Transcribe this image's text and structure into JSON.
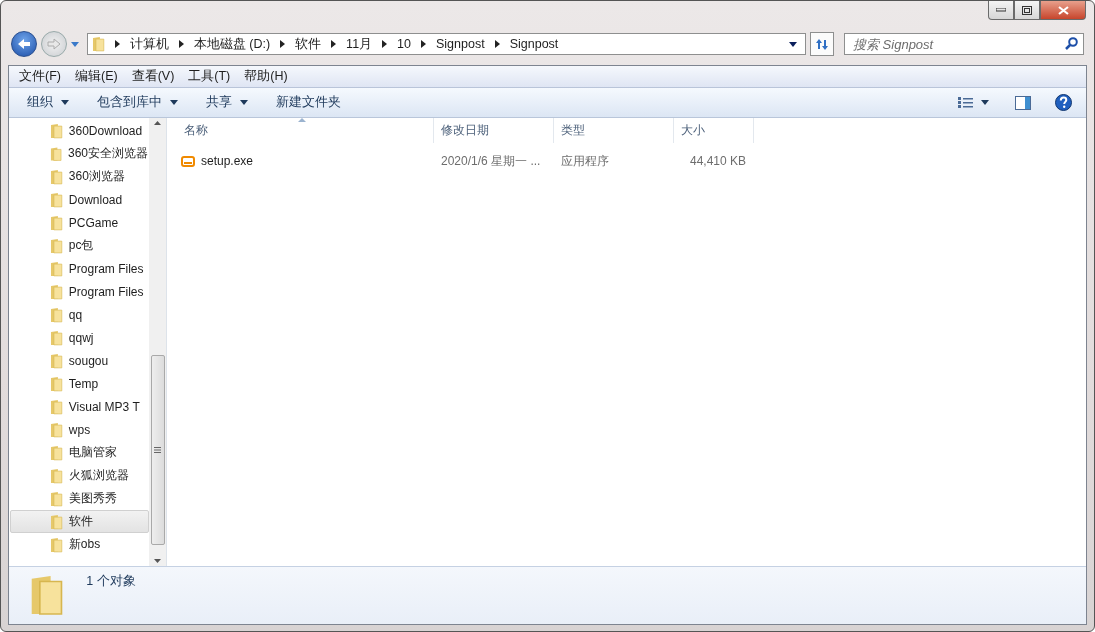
{
  "address_bar": {
    "crumbs": [
      "计算机",
      "本地磁盘 (D:)",
      "软件",
      "11月",
      "10",
      "Signpost",
      "Signpost"
    ]
  },
  "search": {
    "placeholder": "搜索 Signpost"
  },
  "menu_bar": [
    "文件(F)",
    "编辑(E)",
    "查看(V)",
    "工具(T)",
    "帮助(H)"
  ],
  "command_bar": [
    {
      "label": "组织",
      "dropdown": true
    },
    {
      "label": "包含到库中",
      "dropdown": true
    },
    {
      "label": "共享",
      "dropdown": true
    },
    {
      "label": "新建文件夹",
      "dropdown": false
    }
  ],
  "sidebar": {
    "items": [
      {
        "label": "360Download",
        "selected": false
      },
      {
        "label": "360安全浏览器",
        "selected": false
      },
      {
        "label": "360浏览器",
        "selected": false
      },
      {
        "label": "Download",
        "selected": false
      },
      {
        "label": "PCGame",
        "selected": false
      },
      {
        "label": "pc包",
        "selected": false
      },
      {
        "label": "Program Files",
        "selected": false
      },
      {
        "label": "Program Files",
        "selected": false
      },
      {
        "label": "qq",
        "selected": false
      },
      {
        "label": "qqwj",
        "selected": false
      },
      {
        "label": "sougou",
        "selected": false
      },
      {
        "label": "Temp",
        "selected": false
      },
      {
        "label": "Visual MP3 T",
        "selected": false
      },
      {
        "label": "wps",
        "selected": false
      },
      {
        "label": "电脑管家",
        "selected": false
      },
      {
        "label": "火狐浏览器",
        "selected": false
      },
      {
        "label": "美图秀秀",
        "selected": false
      },
      {
        "label": "软件",
        "selected": true
      },
      {
        "label": "新obs",
        "selected": false
      }
    ]
  },
  "table": {
    "columns": [
      "名称",
      "修改日期",
      "类型",
      "大小"
    ],
    "rows": [
      {
        "name": "setup.exe",
        "modified": "2020/1/6 星期一 ...",
        "type": "应用程序",
        "size": "44,410 KB"
      }
    ]
  },
  "status_bar": {
    "text": "1 个对象"
  }
}
